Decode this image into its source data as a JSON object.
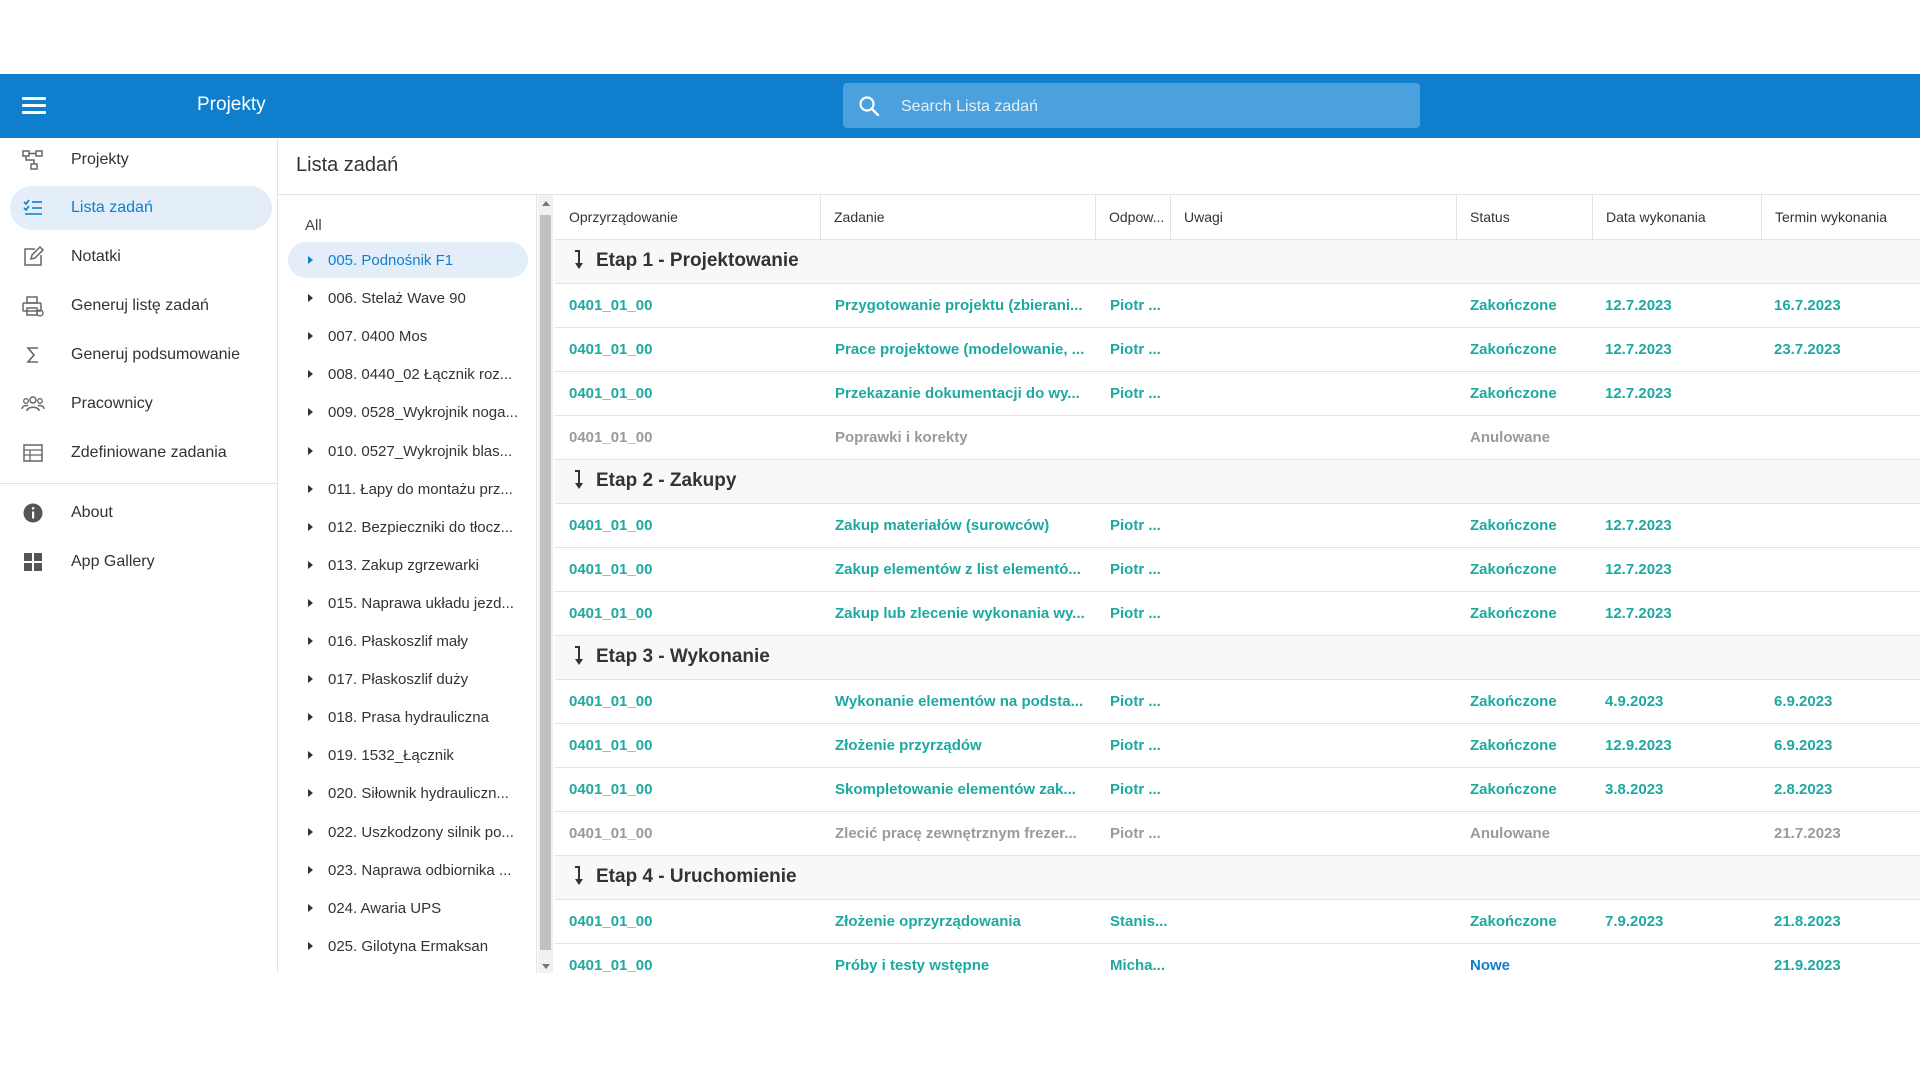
{
  "header": {
    "title": "Projekty",
    "search_placeholder": "Search Lista zadań"
  },
  "sidebar": {
    "items": [
      {
        "label": "Projekty",
        "icon": "projects-icon"
      },
      {
        "label": "Lista zadań",
        "icon": "task-list-icon",
        "active": true
      },
      {
        "label": "Notatki",
        "icon": "notes-icon"
      },
      {
        "label": "Generuj listę zadań",
        "icon": "print-icon"
      },
      {
        "label": "Generuj podsumowanie",
        "icon": "sigma-icon"
      },
      {
        "label": "Pracownicy",
        "icon": "people-icon"
      },
      {
        "label": "Zdefiniowane zadania",
        "icon": "table-icon"
      },
      {
        "label": "About",
        "icon": "info-icon"
      },
      {
        "label": "App Gallery",
        "icon": "app-gallery-icon"
      }
    ]
  },
  "page": {
    "title": "Lista zadań"
  },
  "project_list": {
    "all_label": "All",
    "items": [
      "005. Podnośnik F1",
      "006. Stelaż Wave 90",
      "007. 0400 Mos",
      "008. 0440_02 Łącznik roz...",
      "009. 0528_Wykrojnik noga...",
      "010. 0527_Wykrojnik blas...",
      "011. Łapy do montażu prz...",
      "012. Bezpieczniki do tłocz...",
      "013. Zakup zgrzewarki",
      "015. Naprawa układu jezd...",
      "016. Płaskoszlif mały",
      "017. Płaskoszlif duży",
      "018. Prasa hydrauliczna",
      "019. 1532_Łącznik",
      "020. Siłownik hydrauliczn...",
      "022. Uszkodzony silnik po...",
      "023. Naprawa odbiornika ...",
      "024. Awaria UPS",
      "025. Gilotyna Ermaksan"
    ]
  },
  "table": {
    "columns": [
      "Oprzyrządowanie",
      "Zadanie",
      "Odpow...",
      "Uwagi",
      "Status",
      "Data wykonania",
      "Termin wykonania"
    ],
    "groups": [
      {
        "title": "Etap 1 - Projektowanie",
        "rows": [
          {
            "opr": "0401_01_00",
            "zad": "Przygotowanie projektu (zbierani...",
            "odp": "Piotr ...",
            "uwagi": "",
            "status": "Zakończone",
            "data": "12.7.2023",
            "termin": "16.7.2023"
          },
          {
            "opr": "0401_01_00",
            "zad": "Prace projektowe (modelowanie, ...",
            "odp": "Piotr ...",
            "uwagi": "",
            "status": "Zakończone",
            "data": "12.7.2023",
            "termin": "23.7.2023"
          },
          {
            "opr": "0401_01_00",
            "zad": "Przekazanie dokumentacji do wy...",
            "odp": "Piotr ...",
            "uwagi": "",
            "status": "Zakończone",
            "data": "12.7.2023",
            "termin": ""
          },
          {
            "opr": "0401_01_00",
            "zad": "Poprawki i korekty",
            "odp": "",
            "uwagi": "",
            "status": "Anulowane",
            "data": "",
            "termin": "",
            "muted": true
          }
        ]
      },
      {
        "title": "Etap 2 - Zakupy",
        "rows": [
          {
            "opr": "0401_01_00",
            "zad": "Zakup materiałów (surowców)",
            "odp": "Piotr ...",
            "uwagi": "",
            "status": "Zakończone",
            "data": "12.7.2023",
            "termin": ""
          },
          {
            "opr": "0401_01_00",
            "zad": "Zakup elementów z list elementó...",
            "odp": "Piotr ...",
            "uwagi": "",
            "status": "Zakończone",
            "data": "12.7.2023",
            "termin": ""
          },
          {
            "opr": "0401_01_00",
            "zad": "Zakup lub zlecenie wykonania wy...",
            "odp": "Piotr ...",
            "uwagi": "",
            "status": "Zakończone",
            "data": "12.7.2023",
            "termin": ""
          }
        ]
      },
      {
        "title": "Etap 3 - Wykonanie",
        "rows": [
          {
            "opr": "0401_01_00",
            "zad": "Wykonanie elementów na podsta...",
            "odp": "Piotr ...",
            "uwagi": "",
            "status": "Zakończone",
            "data": "4.9.2023",
            "termin": "6.9.2023"
          },
          {
            "opr": "0401_01_00",
            "zad": "Złożenie przyrządów",
            "odp": "Piotr ...",
            "uwagi": "",
            "status": "Zakończone",
            "data": "12.9.2023",
            "termin": "6.9.2023"
          },
          {
            "opr": "0401_01_00",
            "zad": "Skompletowanie elementów zak...",
            "odp": "Piotr ...",
            "uwagi": "",
            "status": "Zakończone",
            "data": "3.8.2023",
            "termin": "2.8.2023"
          },
          {
            "opr": "0401_01_00",
            "zad": "Zlecić pracę zewnętrznym frezer...",
            "odp": "Piotr ...",
            "uwagi": "",
            "status": "Anulowane",
            "data": "",
            "termin": "21.7.2023",
            "muted": true
          }
        ]
      },
      {
        "title": "Etap 4 - Uruchomienie",
        "rows": [
          {
            "opr": "0401_01_00",
            "zad": "Złożenie oprzyrządowania",
            "odp": "Stanis...",
            "uwagi": "",
            "status": "Zakończone",
            "data": "7.9.2023",
            "termin": "21.8.2023"
          },
          {
            "opr": "0401_01_00",
            "zad": "Próby i testy wstępne",
            "odp": "Micha...",
            "uwagi": "",
            "status": "Nowe",
            "data": "",
            "termin": "21.9.2023",
            "status_color": "blue"
          }
        ]
      }
    ]
  },
  "colors": {
    "appbar": "#0f7fcd",
    "accent_teal": "#1da9a0",
    "muted_gray": "#9a9a9a",
    "selected_bg": "#e3eef8"
  }
}
